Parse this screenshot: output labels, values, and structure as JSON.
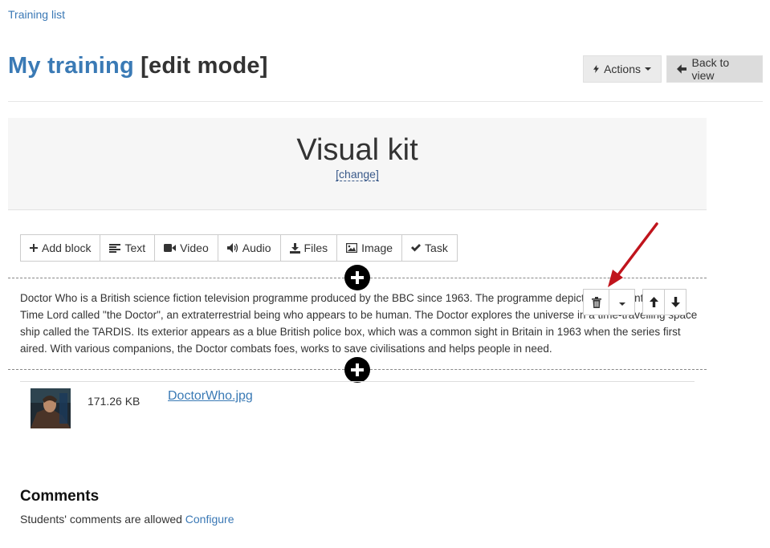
{
  "breadcrumb": {
    "label": "Training list"
  },
  "header": {
    "title_name": "My training",
    "title_mode": "[edit mode]",
    "actions_label": "Actions",
    "back_label": "Back to view"
  },
  "kit": {
    "title": "Visual kit",
    "change_label": "[change]"
  },
  "toolbar": {
    "add_block": "Add block",
    "text": "Text",
    "video": "Video",
    "audio": "Audio",
    "files": "Files",
    "image": "Image",
    "task": "Task"
  },
  "text_block": {
    "content": "Doctor Who is a British science fiction television programme produced by the BBC since 1963. The programme depicts the adventures of a Time Lord called \"the Doctor\", an extraterrestrial being who appears to be human. The Doctor explores the universe in a time-travelling space ship called the TARDIS. Its exterior appears as a blue British police box, which was a common sight in Britain in 1963 when the series first aired. With various companions, the Doctor combats foes, works to save civilisations and helps people in need."
  },
  "file": {
    "size": "171.26 KB",
    "name": "DoctorWho.jpg"
  },
  "comments": {
    "heading": "Comments",
    "text": "Students' comments are allowed",
    "configure_label": "Configure"
  },
  "colors": {
    "link": "#3a7ab5",
    "annotation_arrow": "#c0141c"
  }
}
